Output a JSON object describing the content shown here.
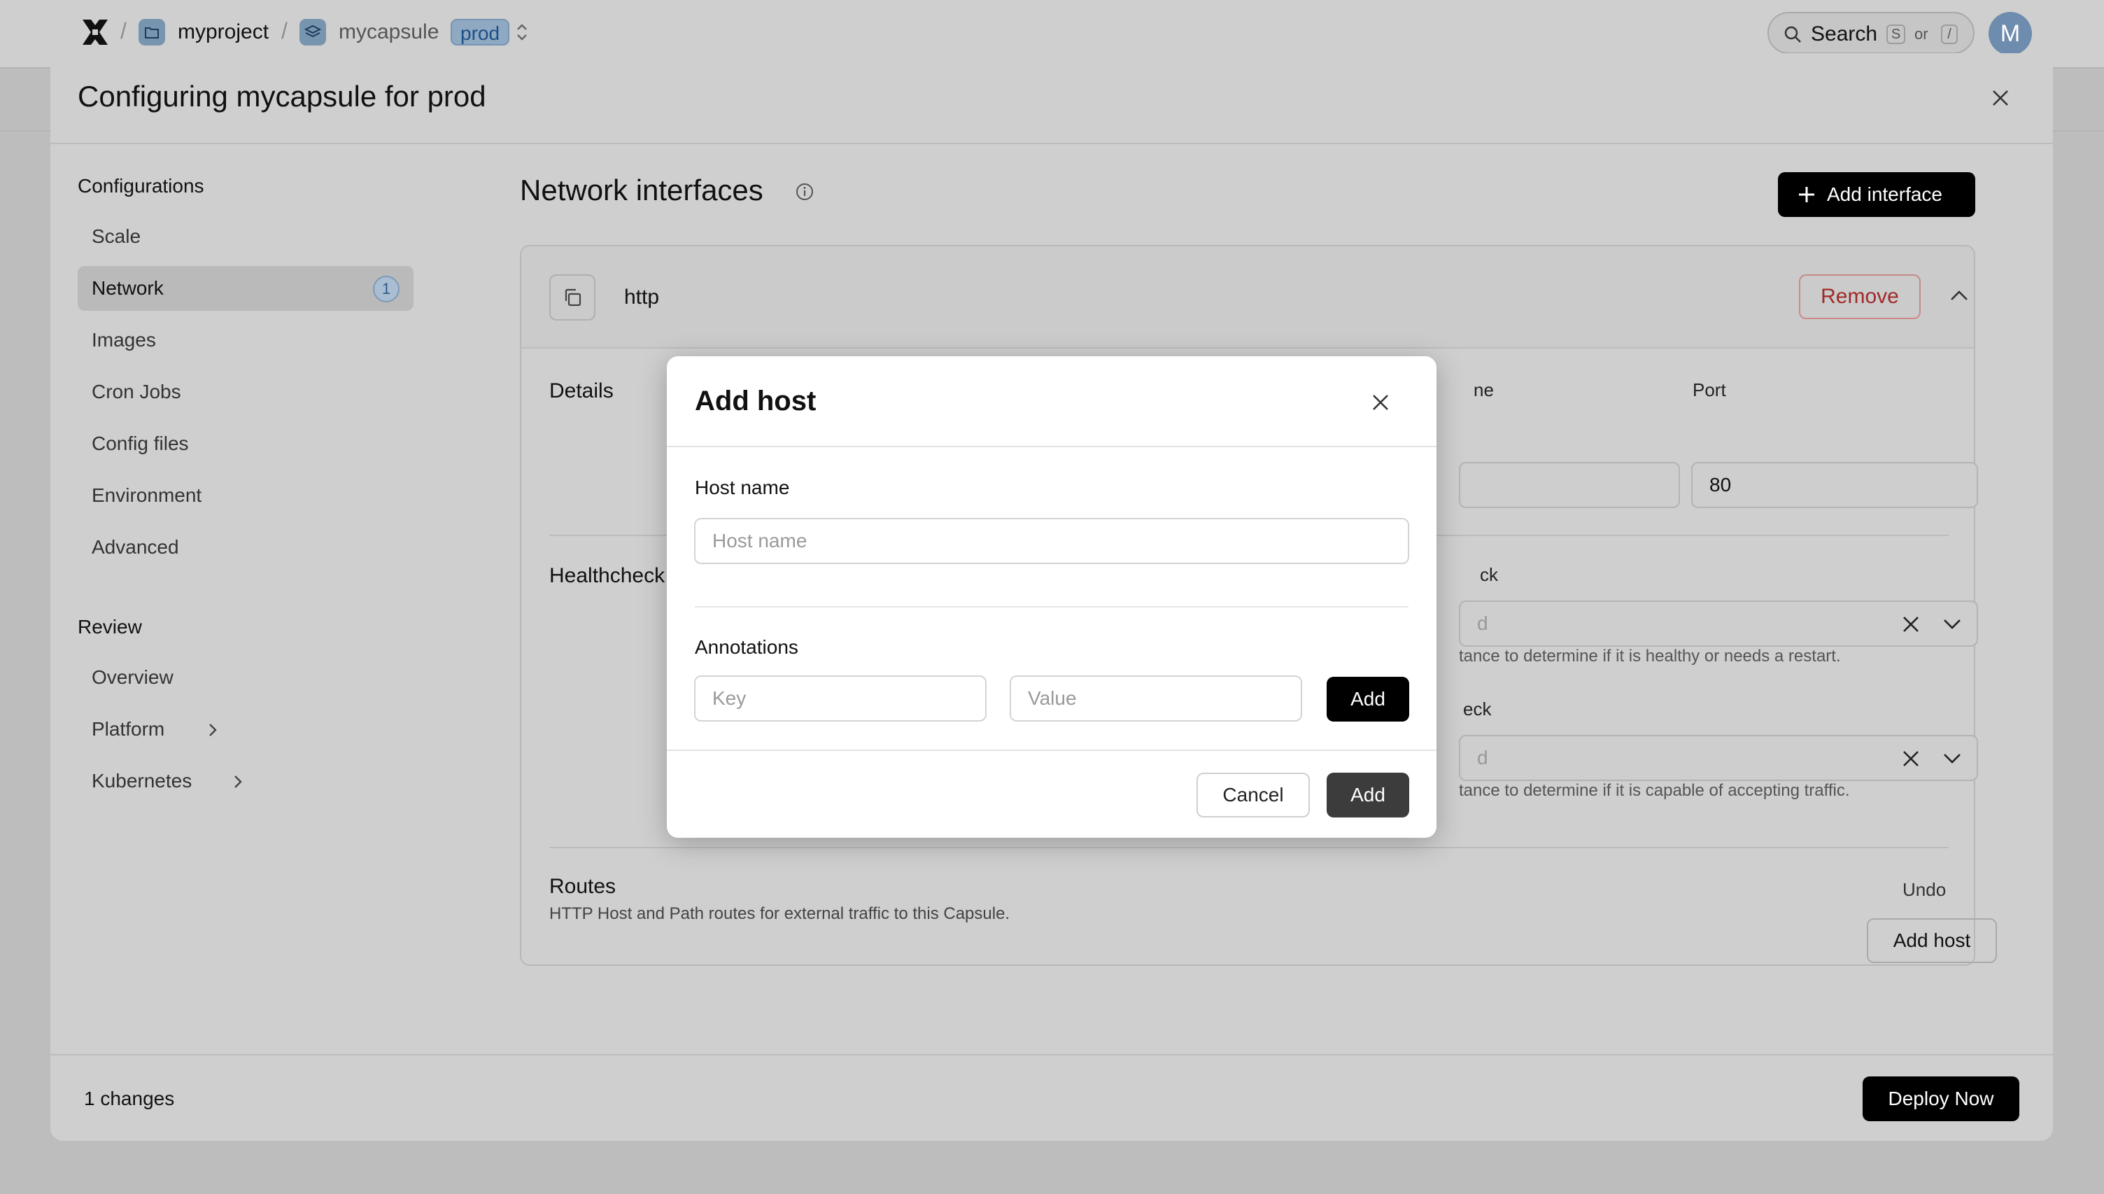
{
  "topbar": {
    "project": "myproject",
    "capsule": "mycapsule",
    "environment": "prod",
    "search_label": "Search",
    "search_key_1": "S",
    "search_or": "or",
    "search_key_2": "/",
    "avatar_initial": "M"
  },
  "panel": {
    "title": "Configuring mycapsule for prod"
  },
  "sidebar": {
    "configurations_heading": "Configurations",
    "config_items": [
      {
        "label": "Scale"
      },
      {
        "label": "Network",
        "badge": "1"
      },
      {
        "label": "Images"
      },
      {
        "label": "Cron Jobs"
      },
      {
        "label": "Config files"
      },
      {
        "label": "Environment"
      },
      {
        "label": "Advanced"
      }
    ],
    "review_heading": "Review",
    "review_items": [
      {
        "label": "Overview"
      },
      {
        "label": "Platform"
      },
      {
        "label": "Kubernetes"
      }
    ]
  },
  "network": {
    "section_title": "Network interfaces",
    "add_interface_label": "Add interface",
    "interface": {
      "name": "http",
      "remove_label": "Remove",
      "details_label": "Details",
      "name_field_label_partial": "ne",
      "port_label": "Port",
      "port_value": "80",
      "healthcheck_label": "Healthcheck",
      "liveness_label_partial": "ck",
      "liveness_placeholder_partial": "d",
      "liveness_helper_partial": "tance to determine if it is healthy or needs a restart.",
      "readiness_label_partial": "eck",
      "readiness_placeholder_partial": "d",
      "readiness_helper_partial": "tance to determine if it is capable of accepting traffic.",
      "routes_label": "Routes",
      "routes_desc": "HTTP Host and Path routes for external traffic to this Capsule.",
      "undo_label": "Undo",
      "add_host_label": "Add host"
    }
  },
  "footer": {
    "changes": "1 changes",
    "deploy_label": "Deploy Now"
  },
  "modal": {
    "title": "Add host",
    "host_name_label": "Host name",
    "host_name_placeholder": "Host name",
    "host_name_value": "",
    "annotations_label": "Annotations",
    "key_placeholder": "Key",
    "value_placeholder": "Value",
    "annotation_add_label": "Add",
    "cancel_label": "Cancel",
    "confirm_label": "Add"
  }
}
